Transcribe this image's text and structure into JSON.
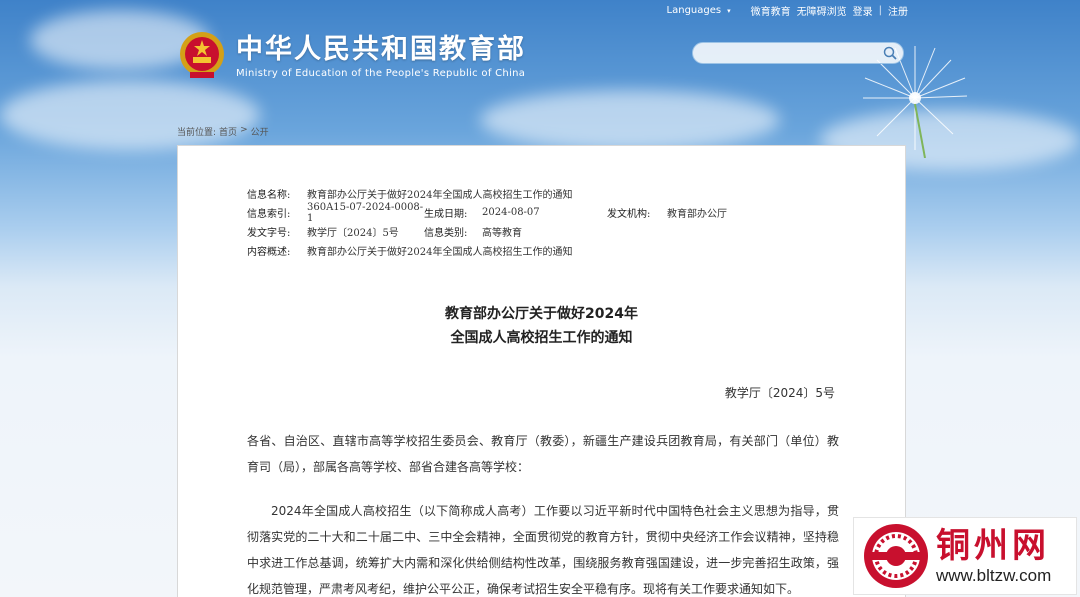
{
  "header": {
    "top_links": [
      "Languages",
      "微育教育",
      "无障碍浏览",
      "登录",
      "注册"
    ],
    "site_name_cn": "中华人民共和国教育部",
    "site_name_en": "Ministry of Education of the People's Republic of China",
    "search_placeholder": ""
  },
  "breadcrumb": {
    "label": "当前位置:",
    "items": [
      "首页",
      "公开"
    ],
    "separator": ">"
  },
  "meta": {
    "title_label": "信息名称:",
    "title_value": "教育部办公厅关于做好2024年全国成人高校招生工作的通知",
    "index_label": "信息索引:",
    "index_value": "360A15-07-2024-0008-1",
    "date_label": "生成日期:",
    "date_value": "2024-08-07",
    "issuer_label": "发文机构:",
    "issuer_value": "教育部办公厅",
    "docno_label": "发文字号:",
    "docno_value": "教学厅〔2024〕5号",
    "category_label": "信息类别:",
    "category_value": "高等教育",
    "summary_label": "内容概述:",
    "summary_value": "教育部办公厅关于做好2024年全国成人高校招生工作的通知"
  },
  "document": {
    "title_line1": "教育部办公厅关于做好2024年",
    "title_line2": "全国成人高校招生工作的通知",
    "doc_number": "教学厅〔2024〕5号",
    "paragraph1": "各省、自治区、直辖市高等学校招生委员会、教育厅（教委），新疆生产建设兵团教育局，有关部门（单位）教育司（局），部属各高等学校、部省合建各高等学校：",
    "paragraph2": "2024年全国成人高校招生（以下简称成人高考）工作要以习近平新时代中国特色社会主义思想为指导，贯彻落实党的二十大和二十届二中、三中全会精神，全面贯彻党的教育方针，贯彻中央经济工作会议精神，坚持稳中求进工作总基调，统筹扩大内需和深化供给侧结构性改革，围绕服务教育强国建设，进一步完善招生政策，强化规范管理，严肃考风考纪，维护公平公正，确保考试招生安全平稳有序。现将有关工作要求通知如下。"
  },
  "watermark": {
    "name_cn": "铜州网",
    "url": "www.bltzw.com"
  },
  "colors": {
    "accent": "#c8102e",
    "sky_top": "#3f82c9"
  }
}
